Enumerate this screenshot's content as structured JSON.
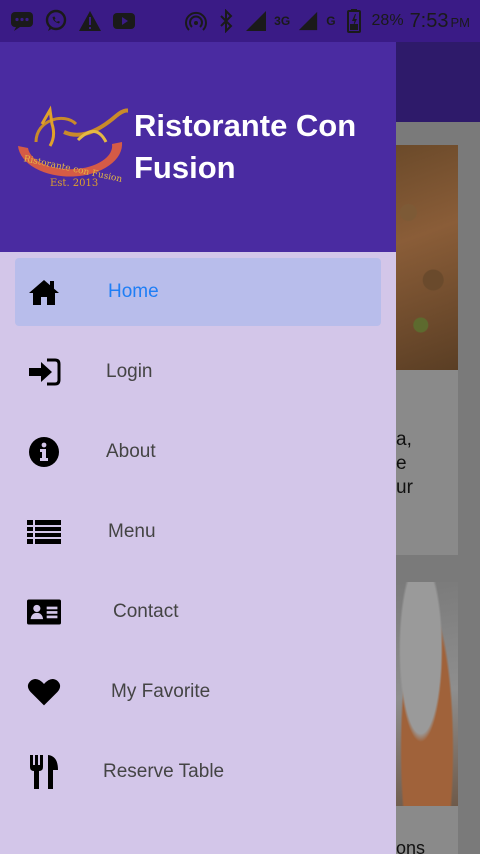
{
  "status_bar": {
    "battery": "28%",
    "time": "7:53",
    "ampm": "PM",
    "network": "3G",
    "network2": "G",
    "icons": [
      "message-icon",
      "whatsapp-icon",
      "warning-icon",
      "youtube-icon",
      "hotspot-icon",
      "bluetooth-icon",
      "signal-icon",
      "battery-icon"
    ]
  },
  "drawer": {
    "title": "Ristorante Con Fusion",
    "logo": {
      "text": "Ristorante con Fusion",
      "est": "Est. 2013"
    },
    "items": [
      {
        "label": "Home",
        "icon": "home-icon",
        "active": true
      },
      {
        "label": "Login",
        "icon": "sign-in-icon",
        "active": false
      },
      {
        "label": "About",
        "icon": "info-circle-icon",
        "active": false
      },
      {
        "label": "Menu",
        "icon": "list-icon",
        "active": false
      },
      {
        "label": "Contact",
        "icon": "address-card-icon",
        "active": false
      },
      {
        "label": "My Favorite",
        "icon": "heart-icon",
        "active": false
      },
      {
        "label": "Reserve Table",
        "icon": "cutlery-icon",
        "active": false
      }
    ]
  },
  "background": {
    "card1_text": "a,\ne\nur",
    "card2_text": "ons"
  },
  "colors": {
    "header": "#4a2ba1",
    "drawer_bg": "#d3c6e9",
    "active_bg": "#b8bdeb",
    "active_text": "#1f7ef5"
  }
}
